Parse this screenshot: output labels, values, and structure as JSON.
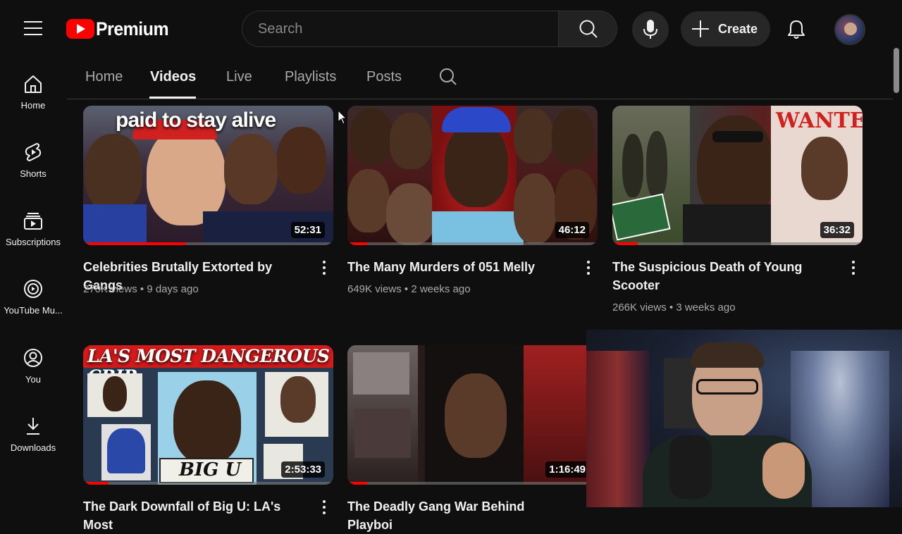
{
  "header": {
    "logo_text": "Premium",
    "search_placeholder": "Search",
    "create_label": "Create"
  },
  "sidebar": {
    "items": [
      {
        "label": "Home",
        "icon": "home-icon"
      },
      {
        "label": "Shorts",
        "icon": "shorts-icon"
      },
      {
        "label": "Subscriptions",
        "icon": "subscriptions-icon"
      },
      {
        "label": "YouTube Mu...",
        "icon": "youtube-music-icon"
      },
      {
        "label": "You",
        "icon": "user-icon"
      },
      {
        "label": "Downloads",
        "icon": "download-icon"
      }
    ]
  },
  "tabs": [
    {
      "label": "Home",
      "active": false
    },
    {
      "label": "Videos",
      "active": true
    },
    {
      "label": "Live",
      "active": false
    },
    {
      "label": "Playlists",
      "active": false
    },
    {
      "label": "Posts",
      "active": false
    }
  ],
  "videos": [
    {
      "title": "Celebrities Brutally Extorted by Gangs",
      "views": "270K views",
      "age": "9 days ago",
      "duration": "52:31",
      "thumb_text": "paid to stay alive",
      "watched_fraction": 0.41
    },
    {
      "title": "The Many Murders of 051 Melly",
      "views": "649K views",
      "age": "2 weeks ago",
      "duration": "46:12",
      "thumb_text": "",
      "watched_fraction": 0.08
    },
    {
      "title": "The Suspicious Death of Young Scooter",
      "views": "266K views",
      "age": "3 weeks ago",
      "duration": "36:32",
      "thumb_text": "WANTED",
      "watched_fraction": 0.1
    },
    {
      "title": "The Dark Downfall of Big U: LA's Most",
      "views": "",
      "age": "",
      "duration": "2:53:33",
      "thumb_text": "LA'S MOST DANGEROUS CRIP",
      "thumb_subtext": "BIG U",
      "watched_fraction": 0.1
    },
    {
      "title": "The Deadly Gang War Behind Playboi",
      "views": "",
      "age": "",
      "duration": "1:16:49",
      "thumb_text": "",
      "watched_fraction": 0.08
    }
  ],
  "colors": {
    "background": "#0f0f0f",
    "brand_red": "#ff0000",
    "text_primary": "#f1f1f1",
    "text_secondary": "#aaaaaa"
  }
}
